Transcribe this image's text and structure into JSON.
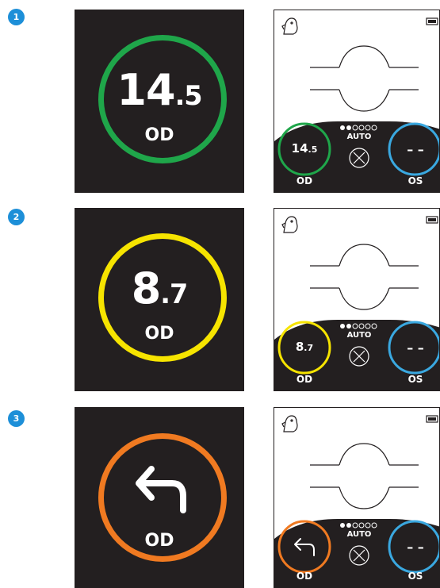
{
  "steps": [
    {
      "number": "1",
      "ring_color": "#1fa64a",
      "display_int": "14",
      "display_dec": ".5",
      "eye_left": "OD",
      "eye_right": "OS",
      "mode": "AUTO",
      "right_value": "– –",
      "icon": "none"
    },
    {
      "number": "2",
      "ring_color": "#f6e400",
      "display_int": "8",
      "display_dec": ".7",
      "eye_left": "OD",
      "eye_right": "OS",
      "mode": "AUTO",
      "right_value": "– –",
      "icon": "none"
    },
    {
      "number": "3",
      "ring_color": "#f07a21",
      "display_int": "",
      "display_dec": "",
      "eye_left": "OD",
      "eye_right": "OS",
      "mode": "AUTO",
      "right_value": "– –",
      "icon": "return-arrow-icon"
    }
  ],
  "colors": {
    "badge": "#1d8fd8",
    "panel": "#231f20",
    "right_ring": "#3aa8e0"
  }
}
